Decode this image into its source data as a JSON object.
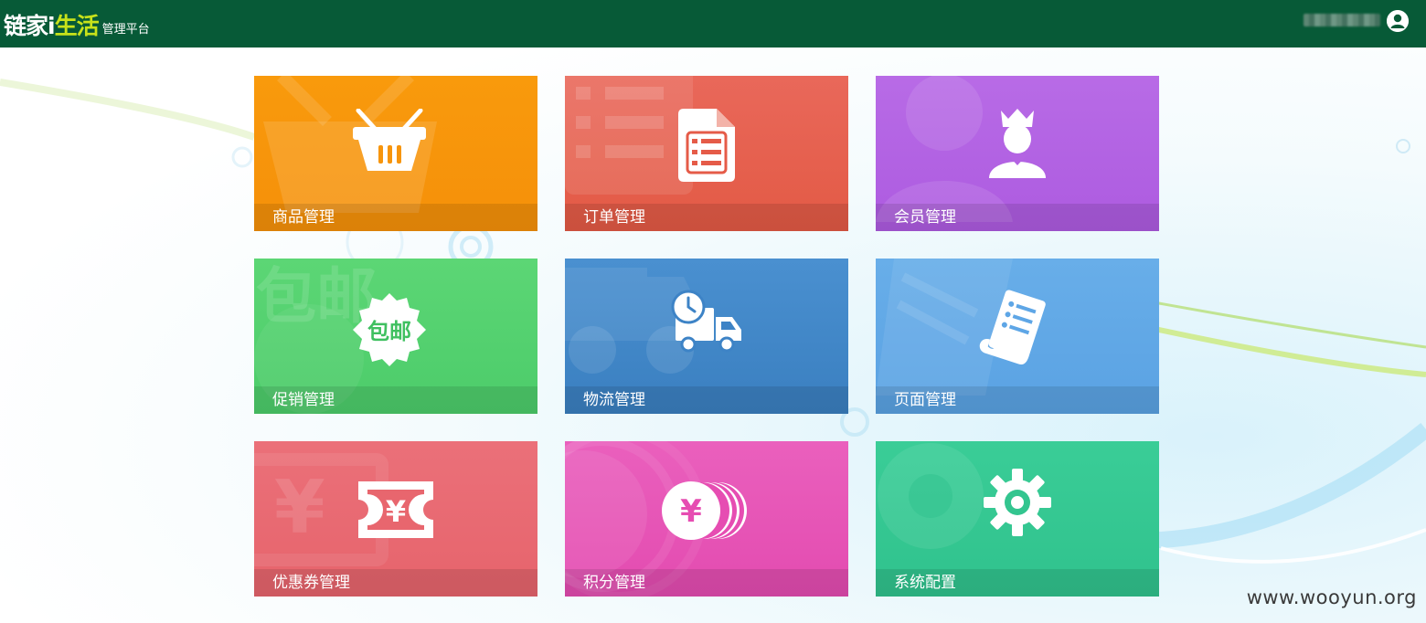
{
  "app": {
    "logo_main": "链家",
    "logo_i": "i",
    "logo_accent": "生活",
    "logo_sub": "管理平台"
  },
  "colors": {
    "topbar": "#075a37",
    "logo_accent": "#c8e21a"
  },
  "user": {
    "name_obscured": true,
    "avatar_icon": "user-avatar-icon"
  },
  "tiles": [
    {
      "label": "商品管理",
      "icon": "shopping-basket-icon",
      "color": "#f7950c"
    },
    {
      "label": "订单管理",
      "icon": "order-document-icon",
      "color": "#e55b48"
    },
    {
      "label": "会员管理",
      "icon": "member-crown-icon",
      "color": "#b463e3"
    },
    {
      "label": "促销管理",
      "icon": "free-shipping-badge-icon",
      "color": "#4fcf68",
      "icon_text": "包邮"
    },
    {
      "label": "物流管理",
      "icon": "delivery-truck-icon",
      "color": "#3d83c6"
    },
    {
      "label": "页面管理",
      "icon": "page-scroll-icon",
      "color": "#5ea6e6"
    },
    {
      "label": "优惠券管理",
      "icon": "coupon-yen-icon",
      "color": "#e8666e",
      "icon_text": "¥"
    },
    {
      "label": "积分管理",
      "icon": "points-coins-icon",
      "color": "#e64db2",
      "icon_text": "¥"
    },
    {
      "label": "系统配置",
      "icon": "settings-gear-icon",
      "color": "#33c58f"
    }
  ],
  "watermark": "www.wooyun.org"
}
